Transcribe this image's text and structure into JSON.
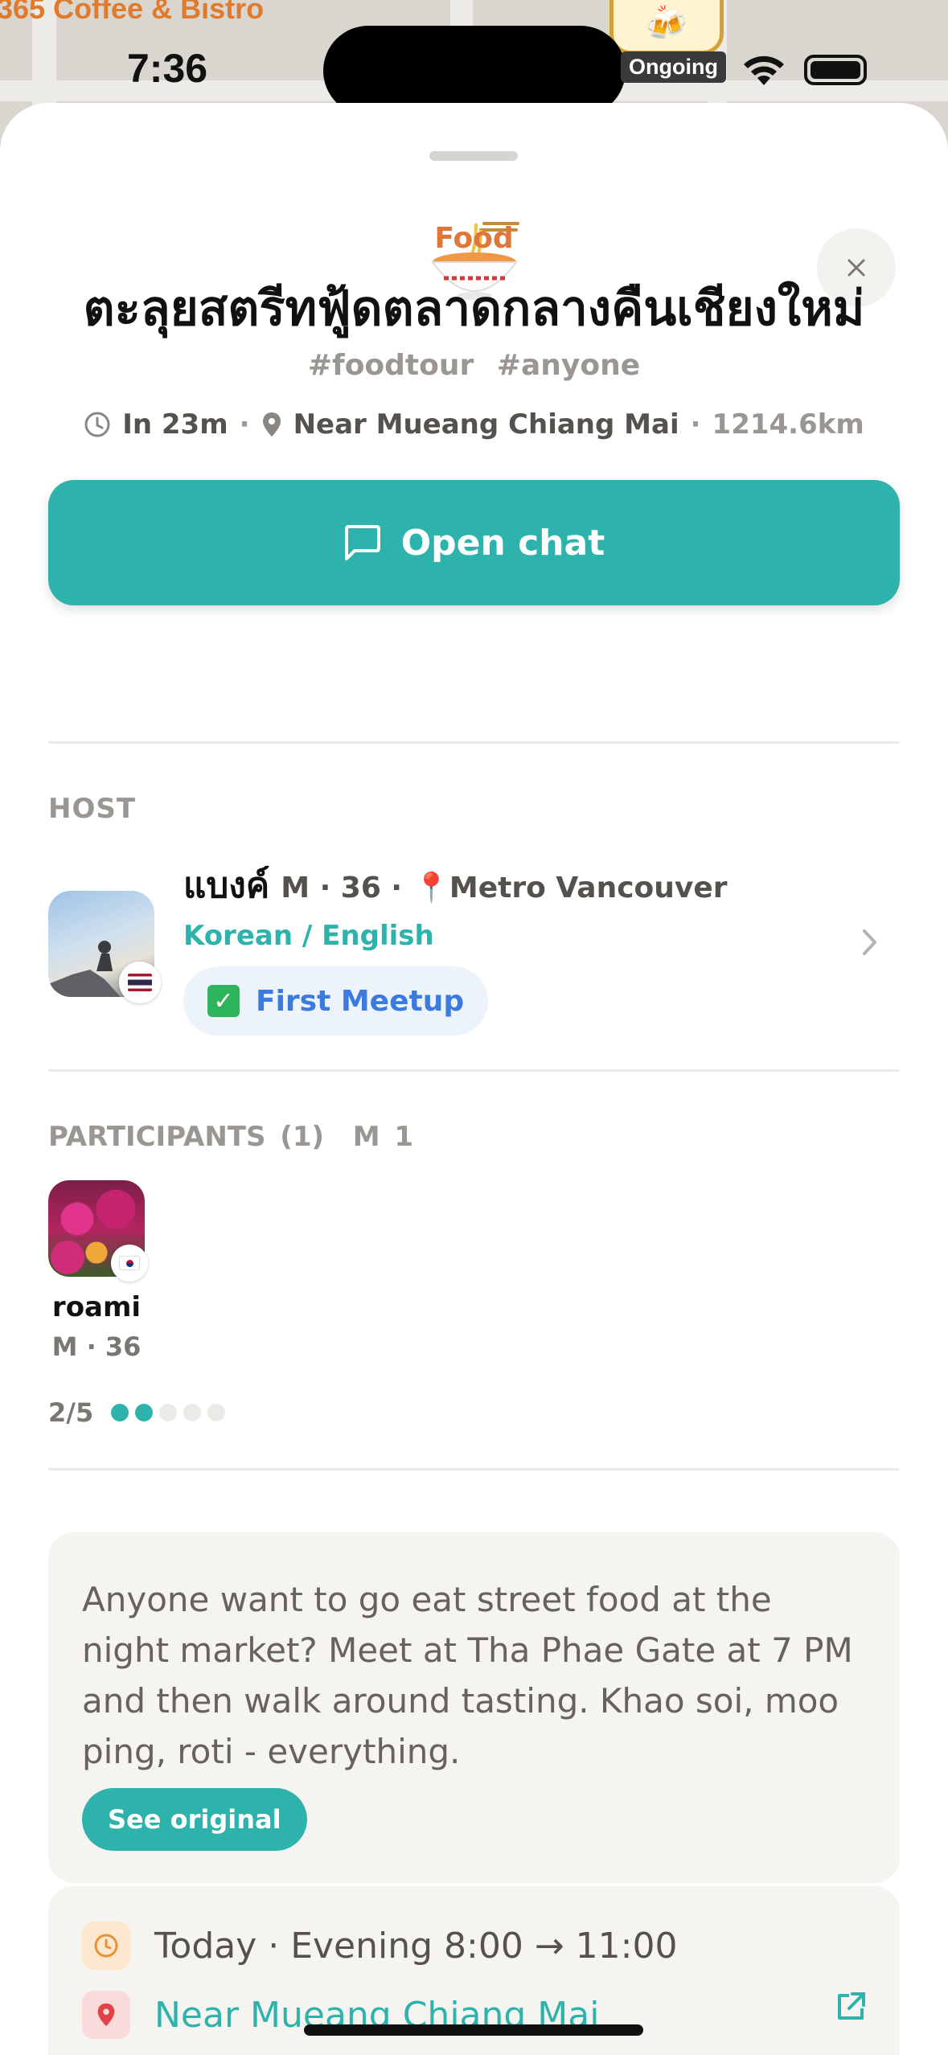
{
  "map": {
    "label": "365 Coffee & Bistro"
  },
  "status_bar": {
    "time": "7:36",
    "ongoing": "Ongoing"
  },
  "event": {
    "category": "Food",
    "title": "ตะลุยสตรีทฟู้ดตลาดกลางคืนเชียงใหม่",
    "tags": "#foodtour #anyone",
    "time_until": "In 23m",
    "location": "Near Mueang Chiang Mai",
    "distance": "1214.6km",
    "open_chat_label": "Open chat"
  },
  "host": {
    "section_label": "HOST",
    "name": "แบงค์",
    "meta": "M · 36 ·",
    "location": "Metro Vancouver",
    "languages": "Korean / English",
    "badge": "First Meetup"
  },
  "participants": {
    "section_label": "PARTICIPANTS (1)",
    "gender_count": "M 1",
    "items": [
      {
        "name": "roami",
        "meta": "M · 36"
      }
    ],
    "capacity_text": "2/5",
    "capacity_filled": 2,
    "capacity_total": 5
  },
  "description": {
    "text": "Anyone want to go eat street food at the night market? Meet at Tha Phae Gate at 7 PM and then walk around tasting. Khao soi, moo ping, roti - everything.",
    "see_original_label": "See original"
  },
  "details": {
    "when": "Today · Evening 8:00 → 11:00",
    "where": "Near Mueang Chiang Mai"
  },
  "colors": {
    "accent": "#2db3ab",
    "category": "#e0773a",
    "badge_text": "#3b7be0"
  },
  "icons": [
    "noodle-bowl-icon",
    "close-icon",
    "clock-icon",
    "location-pin-icon",
    "chat-bubble-icon",
    "chevron-right-icon",
    "check-icon",
    "external-link-icon"
  ]
}
